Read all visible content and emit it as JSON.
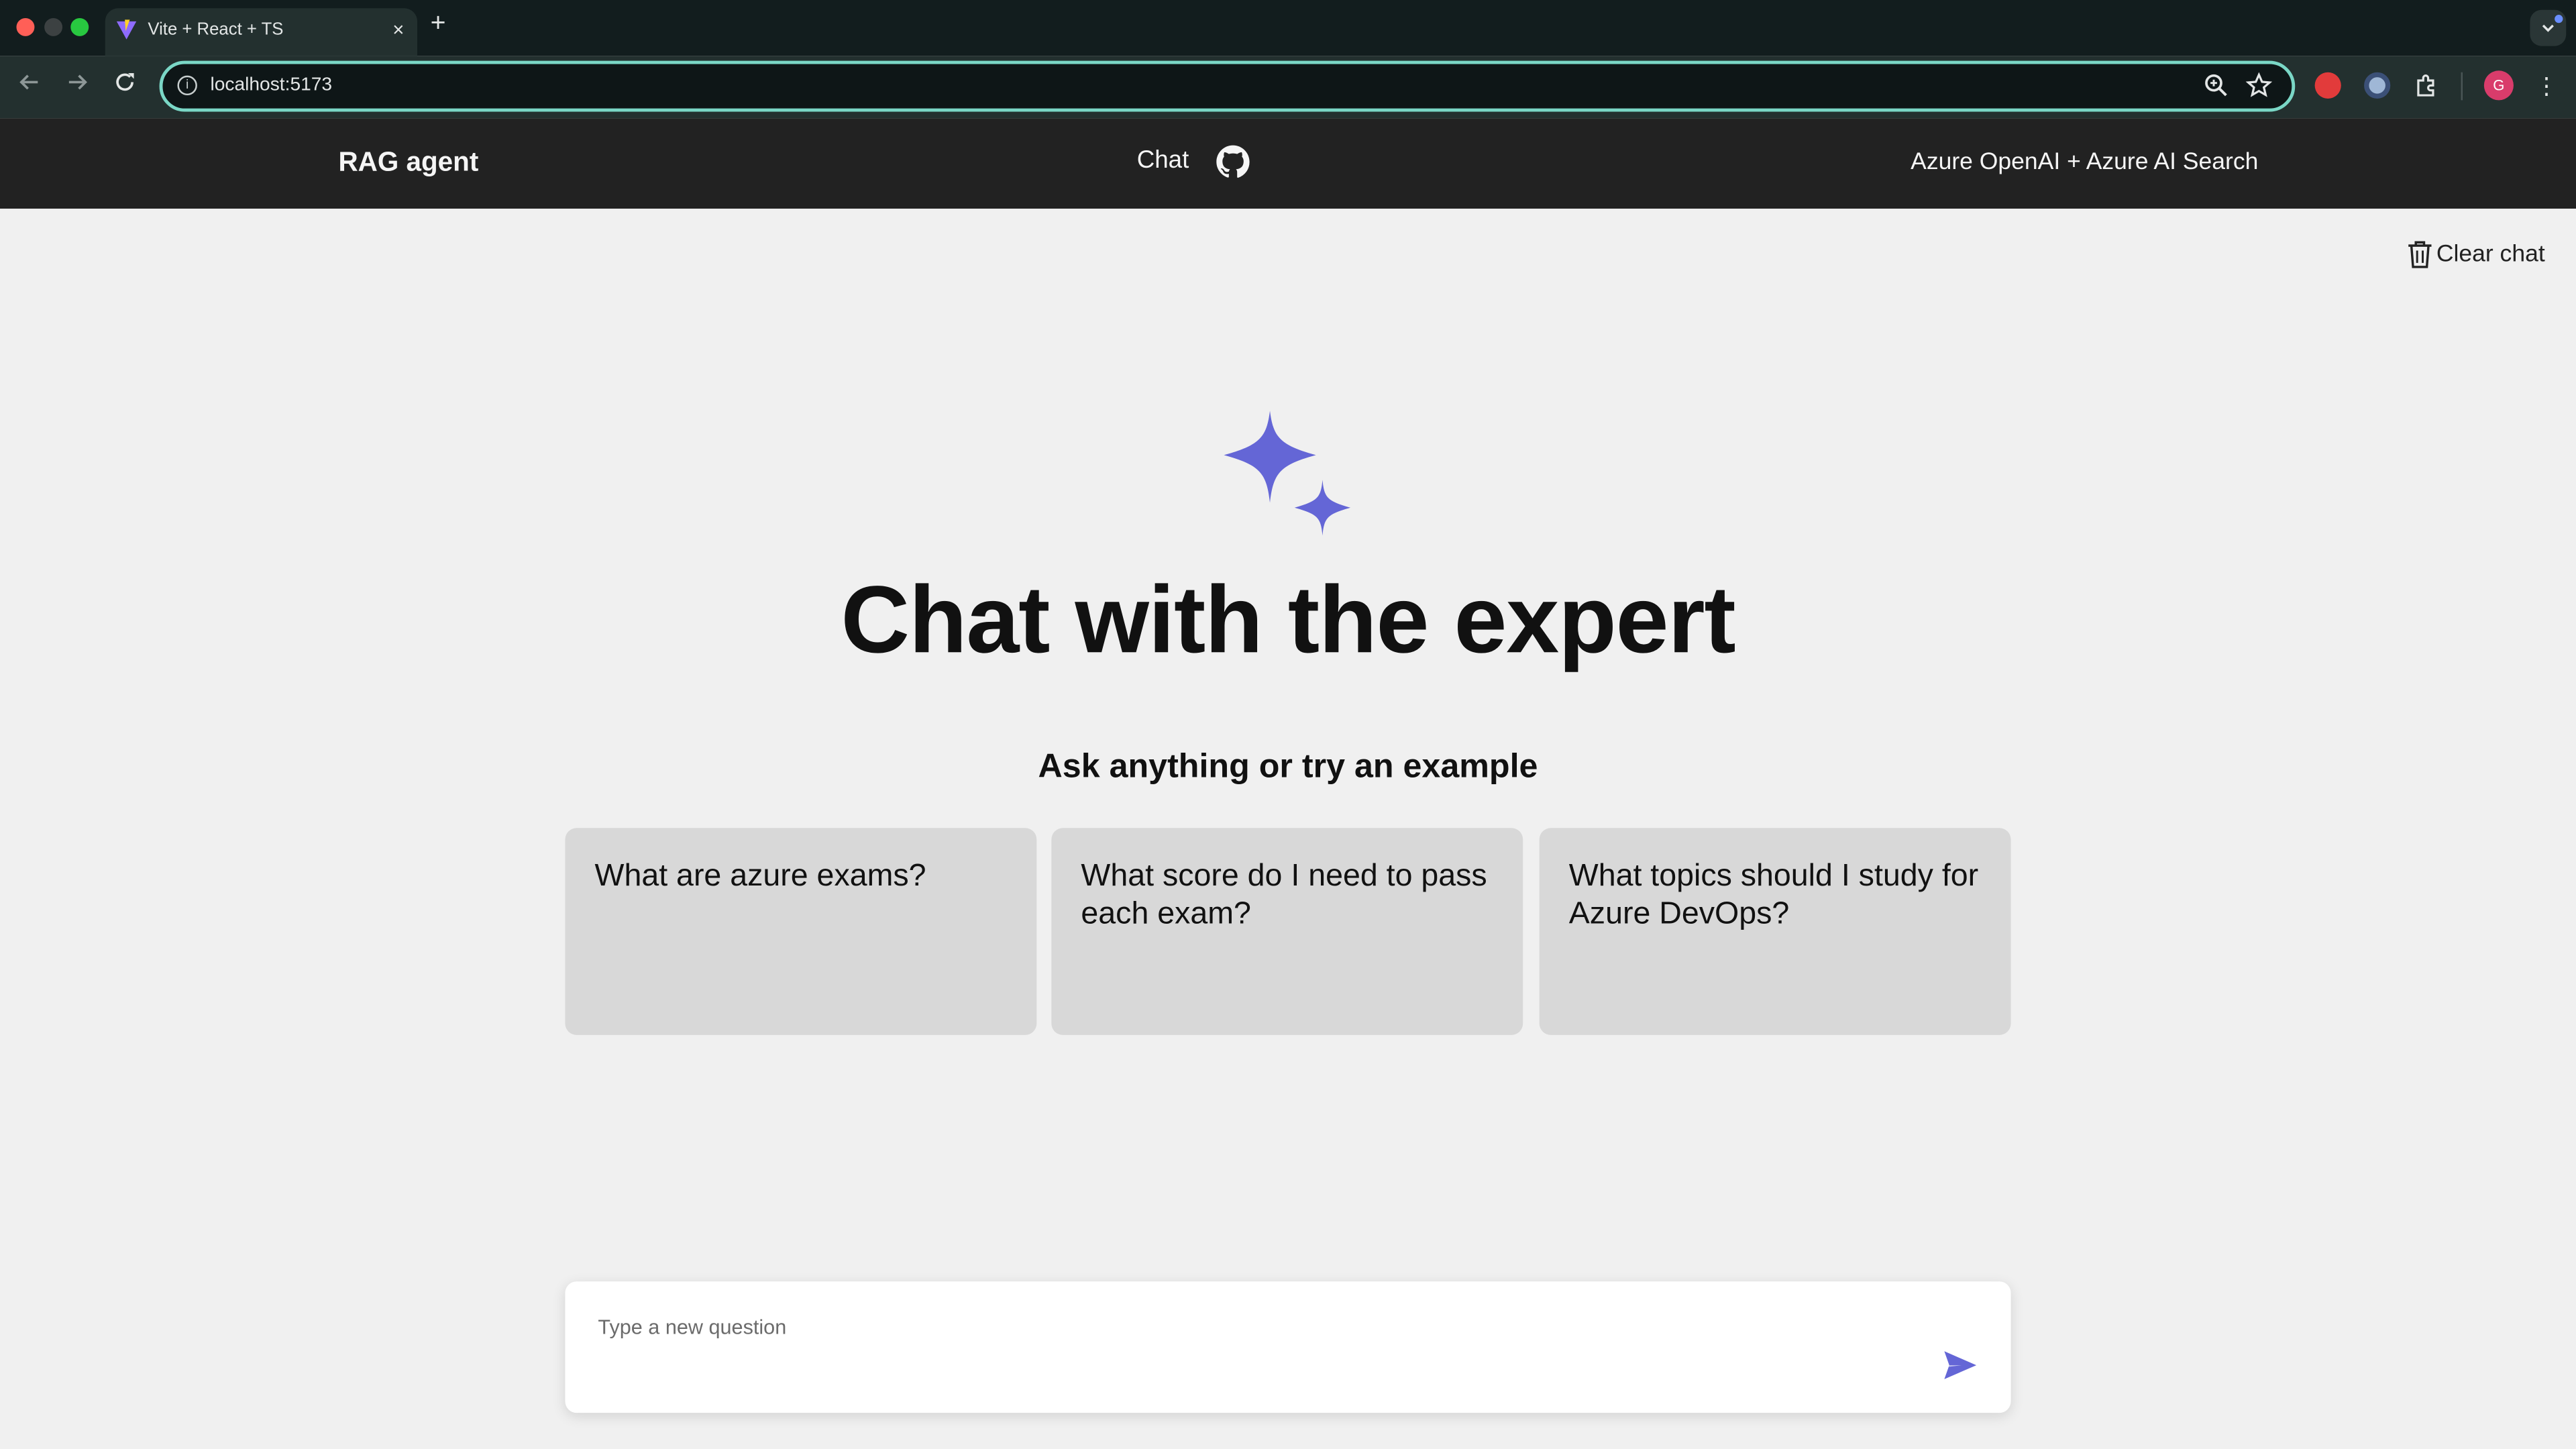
{
  "browser": {
    "tab_title": "Vite + React + TS",
    "tab_close": "×",
    "new_tab": "+",
    "url": "localhost:5173",
    "profile_initial": "G"
  },
  "header": {
    "app_title": "RAG agent",
    "nav_chat": "Chat",
    "right_text": "Azure OpenAI + Azure AI Search"
  },
  "main": {
    "clear_chat_label": "Clear chat",
    "title": "Chat with the expert",
    "subtitle": "Ask anything or try an example",
    "examples": [
      "What are azure exams?",
      "What score do I need to pass each exam?",
      "What topics should I study for Azure DevOps?"
    ],
    "input_placeholder": "Type a new question"
  },
  "colors": {
    "accent": "#6466d6",
    "header_bg": "#222222",
    "page_bg": "#f0f0f0",
    "card_bg": "#d8d8d8"
  }
}
